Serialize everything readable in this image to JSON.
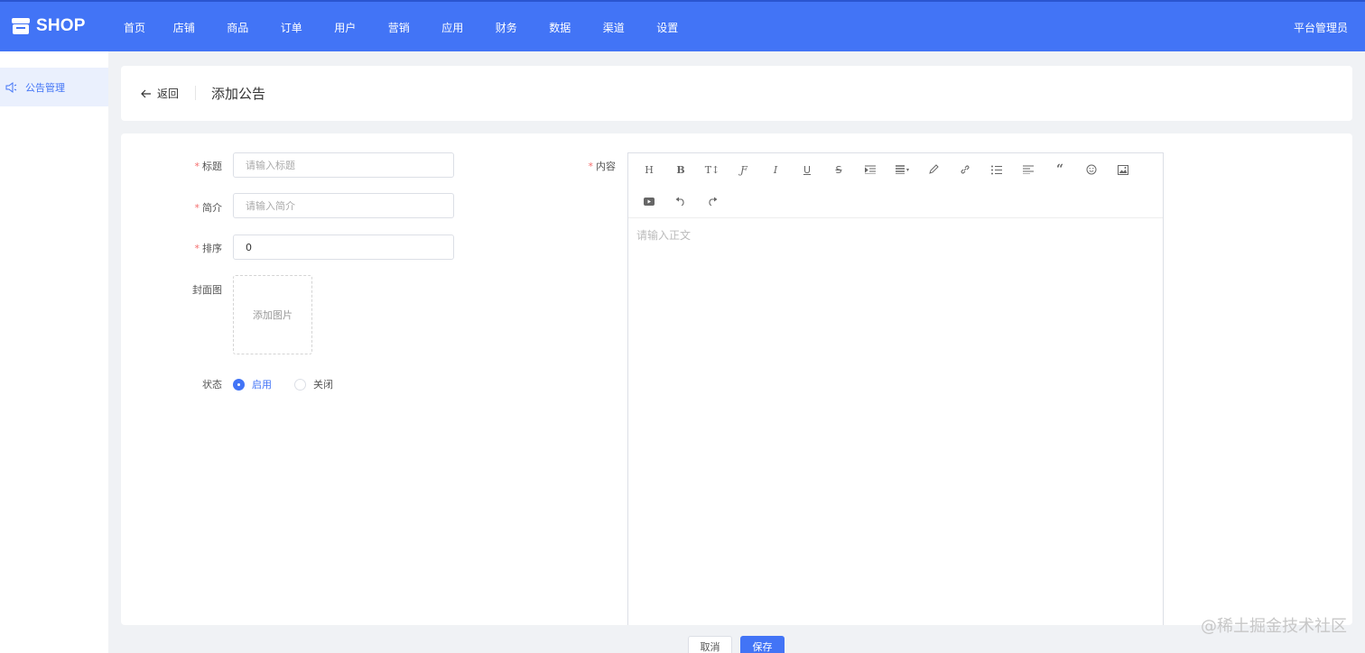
{
  "brand": {
    "name": "SHOP"
  },
  "nav": [
    "首页",
    "店铺",
    "商品",
    "订单",
    "用户",
    "营销",
    "应用",
    "财务",
    "数据",
    "渠道",
    "设置"
  ],
  "admin": "平台管理员",
  "sidebar": {
    "items": [
      {
        "label": "公告管理",
        "icon": "speaker-icon"
      }
    ]
  },
  "header": {
    "back_label": "返回",
    "title": "添加公告"
  },
  "form": {
    "title": {
      "label": "标题",
      "placeholder": "请输入标题",
      "value": ""
    },
    "summary": {
      "label": "简介",
      "placeholder": "请输入简介",
      "value": ""
    },
    "sort": {
      "label": "排序",
      "value": "0"
    },
    "cover": {
      "label": "封面图",
      "upload_label": "添加图片"
    },
    "status": {
      "label": "状态",
      "options": [
        "启用",
        "关闭"
      ],
      "selected": "启用"
    },
    "content": {
      "label": "内容",
      "placeholder": "请输入正文"
    }
  },
  "toolbar": {
    "heading": "H",
    "bold": "B",
    "font_size": "T↕",
    "font_family": "Ƒ",
    "italic": "I",
    "underline": "U",
    "strikethrough": "S"
  },
  "buttons": {
    "cancel": "取消",
    "save": "保存"
  },
  "watermark": "@稀土掘金技术社区",
  "colors": {
    "primary": "#4274f6",
    "required": "#f56c6c"
  }
}
